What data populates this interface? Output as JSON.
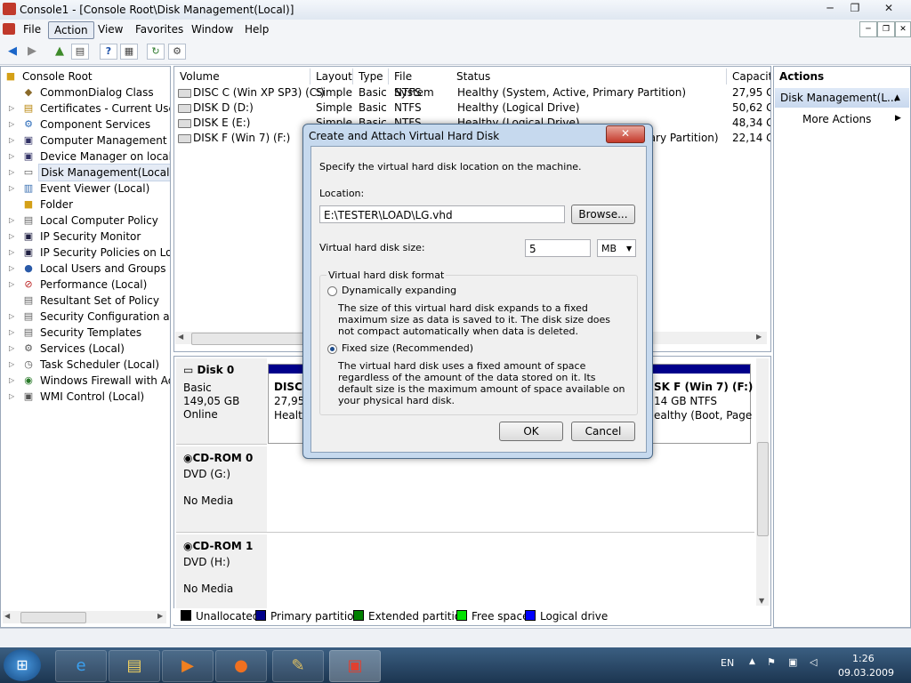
{
  "window": {
    "title": "Console1 - [Console Root\\Disk Management(Local)]",
    "min": "─",
    "restore": "❐",
    "close": "✕",
    "inner_min": "─",
    "inner_restore": "❐",
    "inner_close": "✕"
  },
  "menu": [
    "File",
    "Action",
    "View",
    "Favorites",
    "Window",
    "Help"
  ],
  "tree": {
    "root": "Console Root",
    "items": [
      "CommonDialog Class",
      "Certificates - Current User",
      "Component Services",
      "Computer Management (Lo",
      "Device Manager on local co",
      "Disk Management(Local)",
      "Event Viewer (Local)",
      "Folder",
      "Local Computer Policy",
      "IP Security Monitor",
      "IP Security Policies on Loca",
      "Local Users and Groups (Lo",
      "Performance (Local)",
      "Resultant Set of Policy",
      "Security Configuration and",
      "Security Templates",
      "Services (Local)",
      "Task Scheduler (Local)",
      "Windows Firewall with Adva",
      "WMI Control (Local)"
    ]
  },
  "volumes": {
    "headers": [
      "Volume",
      "Layout",
      "Type",
      "File System",
      "Status",
      "Capacit"
    ],
    "rows": [
      [
        "DISC C (Win XP SP3) (C:)",
        "Simple",
        "Basic",
        "NTFS",
        "Healthy (System, Active, Primary Partition)",
        "27,95 GE"
      ],
      [
        "DISK D (D:)",
        "Simple",
        "Basic",
        "NTFS",
        "Healthy (Logical Drive)",
        "50,62 GE"
      ],
      [
        "DISK E (E:)",
        "Simple",
        "Basic",
        "NTFS",
        "Healthy (Logical Drive)",
        "48,34 GE"
      ],
      [
        "DISK F (Win 7) (F:)",
        "",
        "",
        "",
        "mary Partition)",
        "22,14 GE"
      ]
    ]
  },
  "disks": {
    "disk0": {
      "name": "Disk 0",
      "type": "Basic",
      "size": "149,05 GB",
      "state": "Online",
      "p1_name": "DISC",
      "p1_size": "27,95",
      "p1_status": "Health",
      "p2_name": "SK F (Win 7)  (F:)",
      "p2_size": "14 GB NTFS",
      "p2_status": "ealthy (Boot, Page F"
    },
    "cdrom0": {
      "name": "CD-ROM 0",
      "type": "DVD (G:)",
      "state": "No Media"
    },
    "cdrom1": {
      "name": "CD-ROM 1",
      "type": "DVD (H:)",
      "state": "No Media"
    }
  },
  "legend": [
    {
      "label": "Unallocated",
      "color": "#000000"
    },
    {
      "label": "Primary partition",
      "color": "#00008b"
    },
    {
      "label": "Extended partition",
      "color": "#008000"
    },
    {
      "label": "Free space",
      "color": "#00e000"
    },
    {
      "label": "Logical drive",
      "color": "#0000ff"
    }
  ],
  "actions": {
    "title": "Actions",
    "section": "Disk Management(L...",
    "more": "More Actions"
  },
  "dialog": {
    "title": "Create and Attach Virtual Hard Disk",
    "intro": "Specify the virtual hard disk location on the machine.",
    "location_label": "Location:",
    "location_value": "E:\\TESTER\\LOAD\\LG.vhd",
    "browse": "Browse...",
    "size_label": "Virtual hard disk size:",
    "size_value": "5",
    "unit": "MB",
    "format_label": "Virtual hard disk format",
    "dynamic_label": "Dynamically expanding",
    "dynamic_desc": "The size of this virtual hard disk expands to a fixed maximum size as data is saved to it.  The disk size does not compact automatically when data is deleted.",
    "fixed_label": "Fixed size (Recommended)",
    "fixed_desc": "The virtual hard disk uses a fixed amount of space regardless of the amount of the data stored on it.  Its default size is the maximum amount of space available on your physical hard disk.",
    "ok": "OK",
    "cancel": "Cancel",
    "close": "✕"
  },
  "taskbar": {
    "lang": "EN",
    "time": "1:26",
    "date": "09.03.2009"
  }
}
